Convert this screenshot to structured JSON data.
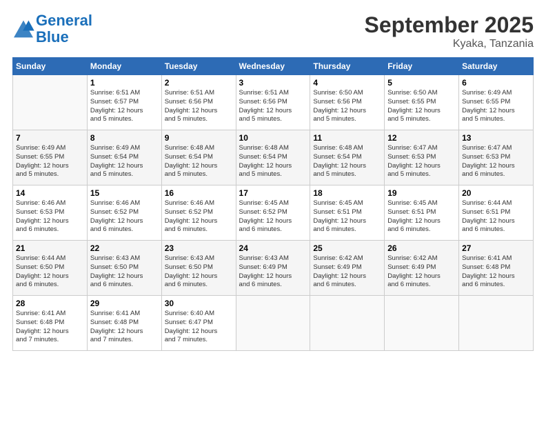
{
  "logo": {
    "line1": "General",
    "line2": "Blue"
  },
  "title": "September 2025",
  "location": "Kyaka, Tanzania",
  "days_of_week": [
    "Sunday",
    "Monday",
    "Tuesday",
    "Wednesday",
    "Thursday",
    "Friday",
    "Saturday"
  ],
  "weeks": [
    [
      {
        "day": "",
        "info": ""
      },
      {
        "day": "1",
        "info": "Sunrise: 6:51 AM\nSunset: 6:57 PM\nDaylight: 12 hours\nand 5 minutes."
      },
      {
        "day": "2",
        "info": "Sunrise: 6:51 AM\nSunset: 6:56 PM\nDaylight: 12 hours\nand 5 minutes."
      },
      {
        "day": "3",
        "info": "Sunrise: 6:51 AM\nSunset: 6:56 PM\nDaylight: 12 hours\nand 5 minutes."
      },
      {
        "day": "4",
        "info": "Sunrise: 6:50 AM\nSunset: 6:56 PM\nDaylight: 12 hours\nand 5 minutes."
      },
      {
        "day": "5",
        "info": "Sunrise: 6:50 AM\nSunset: 6:55 PM\nDaylight: 12 hours\nand 5 minutes."
      },
      {
        "day": "6",
        "info": "Sunrise: 6:49 AM\nSunset: 6:55 PM\nDaylight: 12 hours\nand 5 minutes."
      }
    ],
    [
      {
        "day": "7",
        "info": "Sunrise: 6:49 AM\nSunset: 6:55 PM\nDaylight: 12 hours\nand 5 minutes."
      },
      {
        "day": "8",
        "info": "Sunrise: 6:49 AM\nSunset: 6:54 PM\nDaylight: 12 hours\nand 5 minutes."
      },
      {
        "day": "9",
        "info": "Sunrise: 6:48 AM\nSunset: 6:54 PM\nDaylight: 12 hours\nand 5 minutes."
      },
      {
        "day": "10",
        "info": "Sunrise: 6:48 AM\nSunset: 6:54 PM\nDaylight: 12 hours\nand 5 minutes."
      },
      {
        "day": "11",
        "info": "Sunrise: 6:48 AM\nSunset: 6:54 PM\nDaylight: 12 hours\nand 5 minutes."
      },
      {
        "day": "12",
        "info": "Sunrise: 6:47 AM\nSunset: 6:53 PM\nDaylight: 12 hours\nand 5 minutes."
      },
      {
        "day": "13",
        "info": "Sunrise: 6:47 AM\nSunset: 6:53 PM\nDaylight: 12 hours\nand 6 minutes."
      }
    ],
    [
      {
        "day": "14",
        "info": "Sunrise: 6:46 AM\nSunset: 6:53 PM\nDaylight: 12 hours\nand 6 minutes."
      },
      {
        "day": "15",
        "info": "Sunrise: 6:46 AM\nSunset: 6:52 PM\nDaylight: 12 hours\nand 6 minutes."
      },
      {
        "day": "16",
        "info": "Sunrise: 6:46 AM\nSunset: 6:52 PM\nDaylight: 12 hours\nand 6 minutes."
      },
      {
        "day": "17",
        "info": "Sunrise: 6:45 AM\nSunset: 6:52 PM\nDaylight: 12 hours\nand 6 minutes."
      },
      {
        "day": "18",
        "info": "Sunrise: 6:45 AM\nSunset: 6:51 PM\nDaylight: 12 hours\nand 6 minutes."
      },
      {
        "day": "19",
        "info": "Sunrise: 6:45 AM\nSunset: 6:51 PM\nDaylight: 12 hours\nand 6 minutes."
      },
      {
        "day": "20",
        "info": "Sunrise: 6:44 AM\nSunset: 6:51 PM\nDaylight: 12 hours\nand 6 minutes."
      }
    ],
    [
      {
        "day": "21",
        "info": "Sunrise: 6:44 AM\nSunset: 6:50 PM\nDaylight: 12 hours\nand 6 minutes."
      },
      {
        "day": "22",
        "info": "Sunrise: 6:43 AM\nSunset: 6:50 PM\nDaylight: 12 hours\nand 6 minutes."
      },
      {
        "day": "23",
        "info": "Sunrise: 6:43 AM\nSunset: 6:50 PM\nDaylight: 12 hours\nand 6 minutes."
      },
      {
        "day": "24",
        "info": "Sunrise: 6:43 AM\nSunset: 6:49 PM\nDaylight: 12 hours\nand 6 minutes."
      },
      {
        "day": "25",
        "info": "Sunrise: 6:42 AM\nSunset: 6:49 PM\nDaylight: 12 hours\nand 6 minutes."
      },
      {
        "day": "26",
        "info": "Sunrise: 6:42 AM\nSunset: 6:49 PM\nDaylight: 12 hours\nand 6 minutes."
      },
      {
        "day": "27",
        "info": "Sunrise: 6:41 AM\nSunset: 6:48 PM\nDaylight: 12 hours\nand 6 minutes."
      }
    ],
    [
      {
        "day": "28",
        "info": "Sunrise: 6:41 AM\nSunset: 6:48 PM\nDaylight: 12 hours\nand 7 minutes."
      },
      {
        "day": "29",
        "info": "Sunrise: 6:41 AM\nSunset: 6:48 PM\nDaylight: 12 hours\nand 7 minutes."
      },
      {
        "day": "30",
        "info": "Sunrise: 6:40 AM\nSunset: 6:47 PM\nDaylight: 12 hours\nand 7 minutes."
      },
      {
        "day": "",
        "info": ""
      },
      {
        "day": "",
        "info": ""
      },
      {
        "day": "",
        "info": ""
      },
      {
        "day": "",
        "info": ""
      }
    ]
  ]
}
